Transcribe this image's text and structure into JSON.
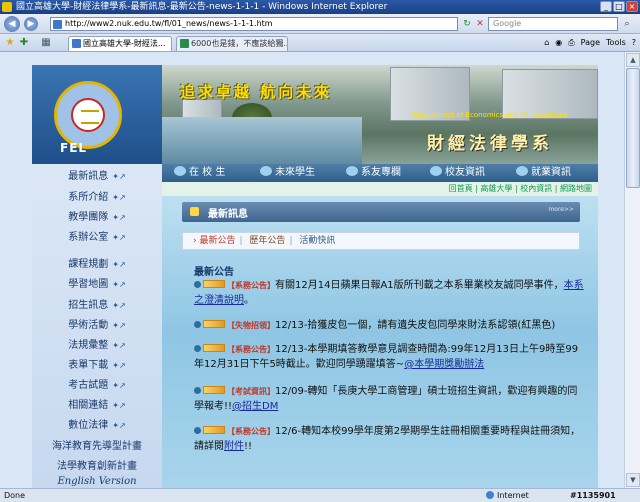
{
  "window": {
    "title": "國立高雄大學-財經法律學系-最新訊息-最新公告-news-1-1-1 - Windows Internet Explorer"
  },
  "toolbar": {
    "url": "http://www2.nuk.edu.tw/fl/01_news/news-1-1-1.htm",
    "search_placeholder": "Google"
  },
  "tabs": [
    {
      "label": "國立高雄大學-財經法..."
    },
    {
      "label": "6000也是錢，不應該給獨..."
    }
  ],
  "tools": {
    "page": "Page",
    "tools": "Tools"
  },
  "status": {
    "text": "Done",
    "zone": "Internet",
    "zoom": "#1135901"
  },
  "banner": {
    "slogan": "追求卓越 航向未來",
    "dept_en": "Department of Economics and Financial Law",
    "dept_zh": "財經法律學系",
    "logo_text": "FEL"
  },
  "topnav": [
    "在 校 生",
    "未來學生",
    "系友專欄",
    "校友資訊",
    "就業資訊"
  ],
  "sublinks": "回首頁 | 高雄大學 | 校內資訊 | 網路地圖",
  "sidebar": [
    "最新訊息",
    "系所介紹",
    "教學團隊",
    "系辦公室",
    "課程規劃",
    "學習地圖",
    "招生訊息",
    "學術活動",
    "法規彙整",
    "表單下載",
    "考古試題",
    "相關連結",
    "數位法律",
    "海洋教育先導型計畫",
    "法學教育創新計畫"
  ],
  "sidebar_english": "English Version",
  "section": {
    "title": "最新訊息",
    "more": "more>>"
  },
  "breadcrumb": {
    "current": "最新公告",
    "item2": "歷年公告",
    "item3": "活動快訊"
  },
  "news_heading": "最新公告",
  "news": [
    {
      "tag": "【系務公告】",
      "text": "有關12月14日蘋果日報A1版所刊載之本系畢業校友誠同學事件，",
      "link": "本系之澄清說明",
      "tail": "。"
    },
    {
      "tag": "【失物招領】",
      "text": "12/13-拾獲皮包一個，請有遺失皮包同學來財法系認領(紅黑色)",
      "link": "",
      "tail": ""
    },
    {
      "tag": "【系務公告】",
      "text": "12/13-本學期填答教學意見調查時間為:99年12月13日上午9時至99年12月31日下午5時截止。歡迎同學踴躍填答~",
      "link": "@本學期獎勵辦法",
      "tail": ""
    },
    {
      "tag": "【考試資訊】",
      "text": "12/09-轉知「長庚大學工商管理」碩士班招生資訊，歡迎有興趣的同學報考!!",
      "link": "@招生DM",
      "tail": ""
    },
    {
      "tag": "【系務公告】",
      "text": "12/6-轉知本校99學年度第2學期學生註冊相關重要時程與註冊須知，請詳閱",
      "link": "附件",
      "tail": "!!"
    }
  ]
}
